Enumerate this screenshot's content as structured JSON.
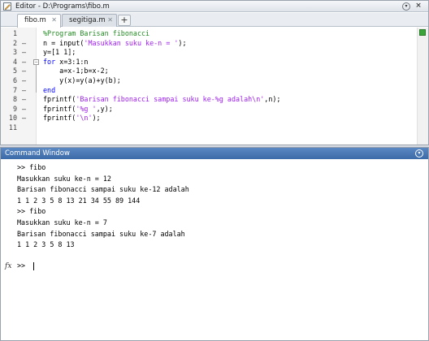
{
  "editor": {
    "title": "Editor - D:\\Programs\\fibo.m",
    "tabs": [
      {
        "label": "fibo.m",
        "active": true
      },
      {
        "label": "segitiga.m",
        "active": false
      }
    ],
    "add_tab_label": "+",
    "lines": [
      {
        "num": "1",
        "dash": "",
        "code": "%Program Barisan fibonacci"
      },
      {
        "num": "2",
        "dash": "–",
        "code": "n = input('Masukkan suku ke-n = ');"
      },
      {
        "num": "3",
        "dash": "–",
        "code": "y=[1 1];"
      },
      {
        "num": "4",
        "dash": "–",
        "code": "for x=3:1:n"
      },
      {
        "num": "5",
        "dash": "–",
        "code": "    a=x-1;b=x-2;"
      },
      {
        "num": "6",
        "dash": "–",
        "code": "    y(x)=y(a)+y(b);"
      },
      {
        "num": "7",
        "dash": "–",
        "code": "end"
      },
      {
        "num": "8",
        "dash": "–",
        "code": "fprintf('Barisan fibonacci sampai suku ke-%g adalah\\n',n);"
      },
      {
        "num": "9",
        "dash": "–",
        "code": "fprintf('%g ',y);"
      },
      {
        "num": "10",
        "dash": "–",
        "code": "fprintf('\\n');"
      },
      {
        "num": "11",
        "dash": "",
        "code": ""
      }
    ],
    "colors": {
      "comment": "#228b22",
      "keyword": "#0000ff",
      "string": "#a020f0"
    }
  },
  "command_window": {
    "title": "Command Window",
    "lines": [
      ">> fibo",
      "Masukkan suku ke-n = 12",
      "Barisan fibonacci sampai suku ke-12 adalah",
      "1 1 2 3 5 8 13 21 34 55 89 144",
      ">> fibo",
      "Masukkan suku ke-n = 7",
      "Barisan fibonacci sampai suku ke-7 adalah",
      "1 1 2 3 5 8 13"
    ],
    "prompt": ">>",
    "fx_label": "fx"
  }
}
